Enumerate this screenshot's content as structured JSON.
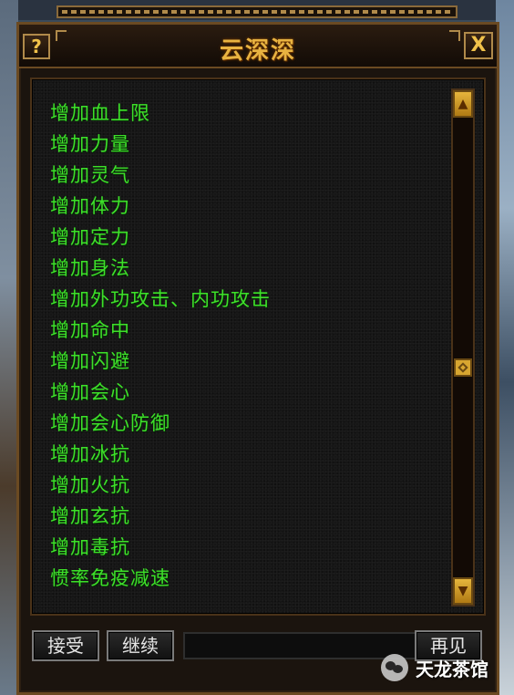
{
  "window": {
    "title": "云深深",
    "help_label": "?",
    "close_label": "X"
  },
  "effects": [
    "增加血上限",
    "增加力量",
    "增加灵气",
    "增加体力",
    "增加定力",
    "增加身法",
    "增加外功攻击、内功攻击",
    "增加命中",
    "增加闪避",
    "增加会心",
    "增加会心防御",
    "增加冰抗",
    "增加火抗",
    "增加玄抗",
    "增加毒抗",
    "惯率免疫减速"
  ],
  "buttons": {
    "accept": "接受",
    "continue": "继续",
    "bye": "再见"
  },
  "watermark": {
    "text": "天龙茶馆"
  },
  "colors": {
    "title": "#e8b341",
    "list_text": "#3ee02a"
  }
}
